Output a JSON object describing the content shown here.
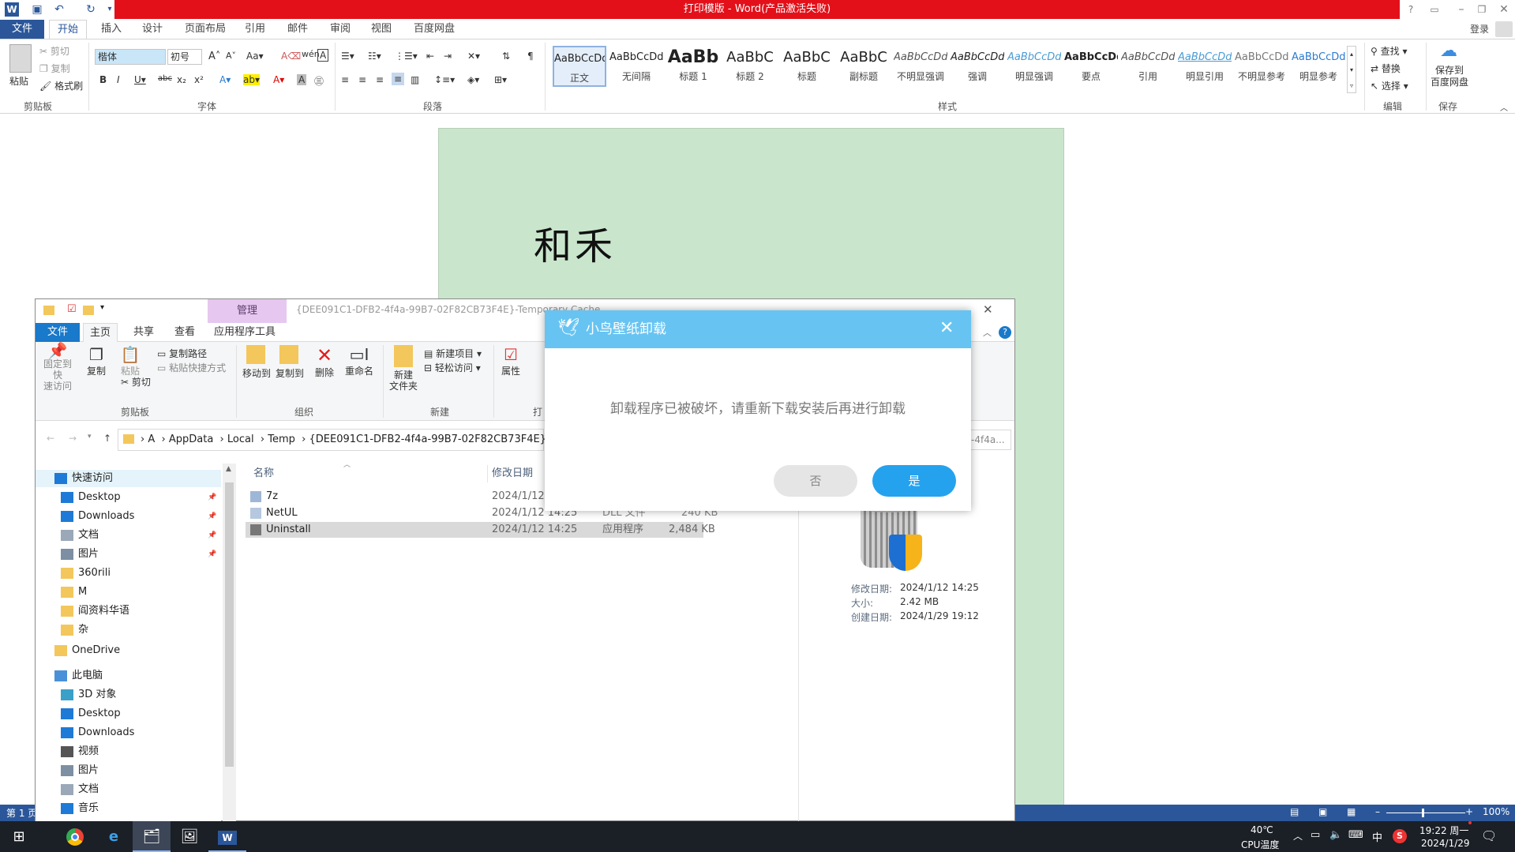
{
  "word": {
    "title": "打印模版 - Word(产品激活失败)",
    "login": "登录",
    "tabs": [
      "文件",
      "开始",
      "插入",
      "设计",
      "页面布局",
      "引用",
      "邮件",
      "审阅",
      "视图",
      "百度网盘"
    ],
    "clipboard": {
      "paste": "粘贴",
      "cut": "剪切",
      "copy": "复制",
      "format_painter": "格式刷",
      "group": "剪贴板"
    },
    "font": {
      "name": "楷体",
      "size": "初号",
      "group": "字体"
    },
    "paragraph": {
      "group": "段落"
    },
    "styles": {
      "group": "样式",
      "items": [
        {
          "preview": "AaBbCcDd",
          "label": "正文"
        },
        {
          "preview": "AaBbCcDd",
          "label": "无间隔"
        },
        {
          "preview": "AaBb",
          "label": "标题 1"
        },
        {
          "preview": "AaBbC",
          "label": "标题 2"
        },
        {
          "preview": "AaBbC",
          "label": "标题"
        },
        {
          "preview": "AaBbC",
          "label": "副标题"
        },
        {
          "preview": "AaBbCcDd",
          "label": "不明显强调"
        },
        {
          "preview": "AaBbCcDd",
          "label": "强调"
        },
        {
          "preview": "AaBbCcDd",
          "label": "明显强调"
        },
        {
          "preview": "AaBbCcDd",
          "label": "要点"
        },
        {
          "preview": "AaBbCcDd",
          "label": "引用"
        },
        {
          "preview": "AaBbCcDd",
          "label": "明显引用"
        },
        {
          "preview": "AaBbCcDd",
          "label": "不明显参考"
        },
        {
          "preview": "AaBbCcDd",
          "label": "明显参考"
        }
      ]
    },
    "editing": {
      "find": "查找",
      "replace": "替换",
      "select": "选择",
      "group": "编辑"
    },
    "save": {
      "label": "保存到\n百度网盘",
      "group": "保存"
    },
    "document_text": "和禾",
    "status": {
      "page": "第 1 页",
      "zoom": "100%"
    }
  },
  "explorer": {
    "title": "{DEE091C1-DFB2-4f4a-99B7-02F82CB73F4E}-Temporary Cache",
    "context_tab": "管理",
    "tabs": [
      "文件",
      "主页",
      "共享",
      "查看",
      "应用程序工具"
    ],
    "ribbon": {
      "pin": "固定到快\n速访问",
      "copy": "复制",
      "paste": "粘贴",
      "copy_path": "复制路径",
      "paste_shortcut": "粘贴快捷方式",
      "cut": "剪切",
      "clipboard_group": "剪贴板",
      "move_to": "移动到",
      "copy_to": "复制到",
      "delete": "删除",
      "rename": "重命名",
      "organize_group": "组织",
      "new_folder": "新建\n文件夹",
      "new_item": "新建项目",
      "easy_access": "轻松访问",
      "new_group": "新建",
      "properties": "属性",
      "open_group": "打"
    },
    "address": [
      "A",
      "AppData",
      "Local",
      "Temp",
      "{DEE091C1-DFB2-4f4a-99B7-02F82CB73F4E}-Te"
    ],
    "search_hint": "-4f4a...",
    "nav": [
      {
        "label": "快速访问",
        "type": "star",
        "indent": 0
      },
      {
        "label": "Desktop",
        "type": "desktop",
        "indent": 1
      },
      {
        "label": "Downloads",
        "type": "download",
        "indent": 1
      },
      {
        "label": "文档",
        "type": "doc",
        "indent": 1
      },
      {
        "label": "图片",
        "type": "pic",
        "indent": 1
      },
      {
        "label": "360rili",
        "type": "folder",
        "indent": 1
      },
      {
        "label": "M",
        "type": "folder",
        "indent": 1
      },
      {
        "label": "阎资料华语",
        "type": "folder",
        "indent": 1
      },
      {
        "label": "杂",
        "type": "folder",
        "indent": 1
      },
      {
        "label": "OneDrive",
        "type": "folder",
        "indent": 0
      },
      {
        "label": "此电脑",
        "type": "pc",
        "indent": 0
      },
      {
        "label": "3D 对象",
        "type": "3d",
        "indent": 1
      },
      {
        "label": "Desktop",
        "type": "desktop",
        "indent": 1
      },
      {
        "label": "Downloads",
        "type": "download",
        "indent": 1
      },
      {
        "label": "视频",
        "type": "video",
        "indent": 1
      },
      {
        "label": "图片",
        "type": "pic",
        "indent": 1
      },
      {
        "label": "文档",
        "type": "doc",
        "indent": 1
      },
      {
        "label": "音乐",
        "type": "music",
        "indent": 1
      }
    ],
    "columns": {
      "name": "名称",
      "date": "修改日期"
    },
    "files": [
      {
        "name": "7z",
        "date": "2024/1/12 14:25",
        "type": "",
        "size": ""
      },
      {
        "name": "NetUL",
        "date": "2024/1/12 14:25",
        "type": "DLL 文件",
        "size": "240 KB"
      },
      {
        "name": "Uninstall",
        "date": "2024/1/12 14:25",
        "type": "应用程序",
        "size": "2,484 KB"
      }
    ],
    "preview": {
      "modified_label": "修改日期:",
      "modified": "2024/1/12 14:25",
      "size_label": "大小:",
      "size": "2.42 MB",
      "created_label": "创建日期:",
      "created": "2024/1/29 19:12"
    }
  },
  "dialog": {
    "title": "小鸟壁纸卸载",
    "message": "卸载程序已被破坏，请重新下载安装后再进行卸载",
    "no": "否",
    "yes": "是"
  },
  "taskbar": {
    "temp": "40℃",
    "temp_label": "CPU温度",
    "ime": "中",
    "time": "19:22 周一",
    "date": "2024/1/29"
  }
}
